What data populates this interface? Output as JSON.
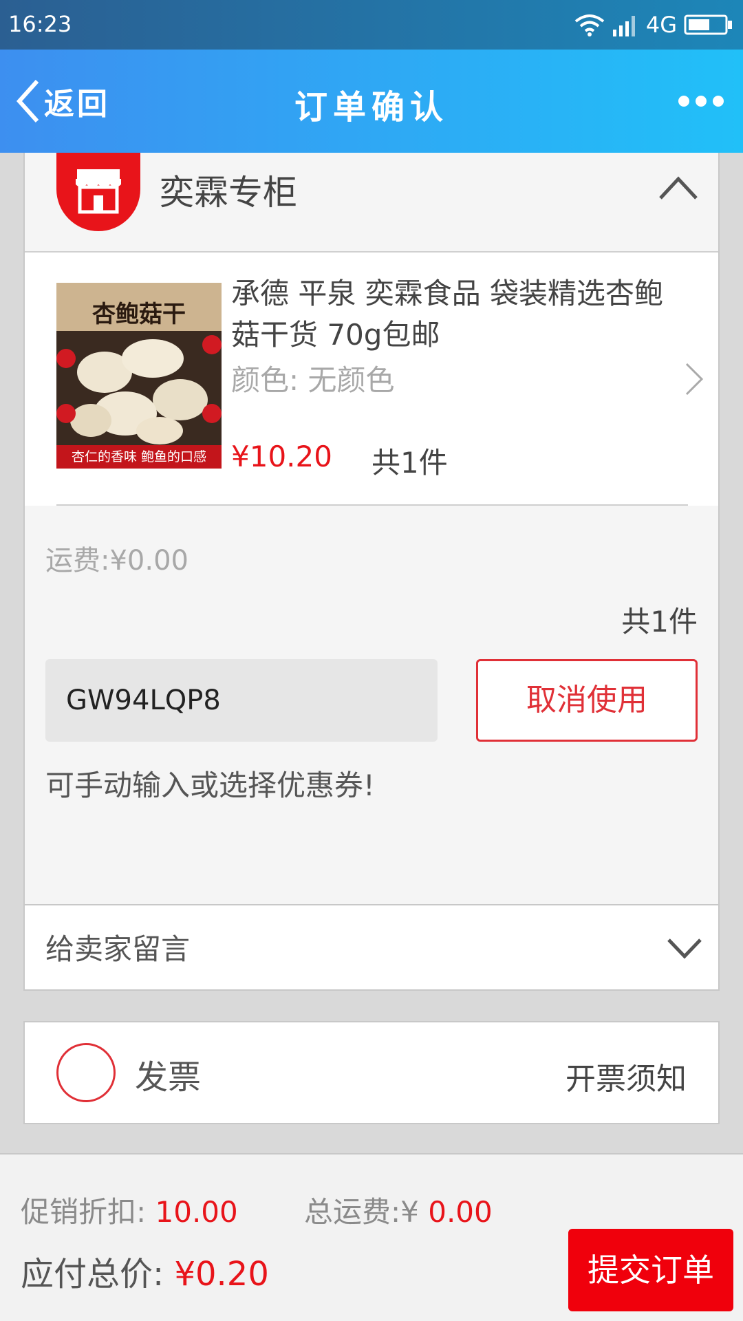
{
  "status_bar": {
    "time": "16:23",
    "network": "4G"
  },
  "header": {
    "back_label": "返回",
    "title": "订单确认"
  },
  "shop": {
    "name": "奕霖专柜",
    "product": {
      "title": "承德 平泉 奕霖食品 袋装精选杏鲍菇干货 70g包邮",
      "color": "颜色: 无颜色",
      "price": "¥10.20",
      "quantity": "共1件",
      "image_title": "杏鲍菇干",
      "image_banner": "杏仁的香味 鲍鱼的口感"
    },
    "shipping": "运费:¥0.00",
    "total_quantity": "共1件",
    "coupon_code": "GW94LQP8",
    "cancel_label": "取消使用",
    "coupon_hint": "可手动输入或选择优惠券!",
    "message_label": "给卖家留言"
  },
  "invoice": {
    "label": "发票",
    "notice": "开票须知"
  },
  "footer": {
    "discount_label": "促销折扣: ",
    "discount_value": "10.00",
    "freight_label": "总运费:¥ ",
    "freight_value": "0.00",
    "total_label": "应付总价: ",
    "total_value": "¥0.20",
    "submit_label": "提交订单"
  },
  "colors": {
    "accent": "#e8141a",
    "header_start": "#3d8ff0",
    "header_end": "#21c0f8"
  }
}
